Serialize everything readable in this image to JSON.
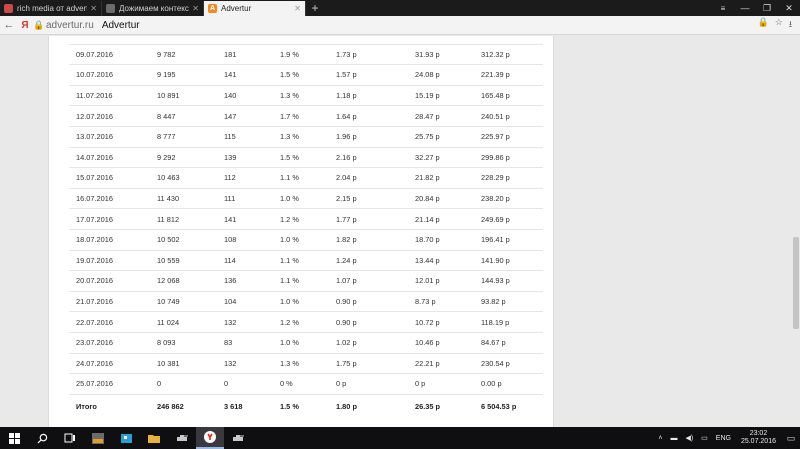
{
  "tabs": [
    {
      "title": "rich media от advertu",
      "favicon_color": "#c94b4b",
      "active": false
    },
    {
      "title": "Дожимаем контекстн",
      "favicon_color": "#6b6b6b",
      "active": false
    },
    {
      "title": "Advertur",
      "favicon_color": "#f08a24",
      "favicon_letter": "A",
      "active": true
    }
  ],
  "address": {
    "url": "advertur.ru",
    "page_title": "Advertur"
  },
  "table": {
    "rows": [
      [
        "09.07.2016",
        "9 782",
        "181",
        "1.9 %",
        "1.73 р",
        "31.93 р",
        "312.32 р"
      ],
      [
        "10.07.2016",
        "9 195",
        "141",
        "1.5 %",
        "1.57 р",
        "24.08 р",
        "221.39 р"
      ],
      [
        "11.07.2016",
        "10 891",
        "140",
        "1.3 %",
        "1.18 р",
        "15.19 р",
        "165.48 р"
      ],
      [
        "12.07.2016",
        "8 447",
        "147",
        "1.7 %",
        "1.64 р",
        "28.47 р",
        "240.51 р"
      ],
      [
        "13.07.2016",
        "8 777",
        "115",
        "1.3 %",
        "1.96 р",
        "25.75 р",
        "225.97 р"
      ],
      [
        "14.07.2016",
        "9 292",
        "139",
        "1.5 %",
        "2.16 р",
        "32.27 р",
        "299.86 р"
      ],
      [
        "15.07.2016",
        "10 463",
        "112",
        "1.1 %",
        "2.04 р",
        "21.82 р",
        "228.29 р"
      ],
      [
        "16.07.2016",
        "11 430",
        "111",
        "1.0 %",
        "2.15 р",
        "20.84 р",
        "238.20 р"
      ],
      [
        "17.07.2016",
        "11 812",
        "141",
        "1.2 %",
        "1.77 р",
        "21.14 р",
        "249.69 р"
      ],
      [
        "18.07.2016",
        "10 502",
        "108",
        "1.0 %",
        "1.82 р",
        "18.70 р",
        "196.41 р"
      ],
      [
        "19.07.2016",
        "10 559",
        "114",
        "1.1 %",
        "1.24 р",
        "13.44 р",
        "141.90 р"
      ],
      [
        "20.07.2016",
        "12 068",
        "136",
        "1.1 %",
        "1.07 р",
        "12.01 р",
        "144.93 р"
      ],
      [
        "21.07.2016",
        "10 749",
        "104",
        "1.0 %",
        "0.90 р",
        "8.73 р",
        "93.82 р"
      ],
      [
        "22.07.2016",
        "11 024",
        "132",
        "1.2 %",
        "0.90 р",
        "10.72 р",
        "118.19 р"
      ],
      [
        "23.07.2016",
        "8 093",
        "83",
        "1.0 %",
        "1.02 р",
        "10.46 р",
        "84.67 р"
      ],
      [
        "24.07.2016",
        "10 381",
        "132",
        "1.3 %",
        "1.75 р",
        "22.21 р",
        "230.54 р"
      ],
      [
        "25.07.2016",
        "0",
        "0",
        "0 %",
        "0 р",
        "0 р",
        "0.00 р"
      ]
    ],
    "total": [
      "Итого",
      "246 862",
      "3 618",
      "1.5 %",
      "1.80 р",
      "26.35 р",
      "6 504.53 р"
    ]
  },
  "taskbar": {
    "lang": "ENG",
    "time": "23:02",
    "date": "25.07.2016"
  }
}
